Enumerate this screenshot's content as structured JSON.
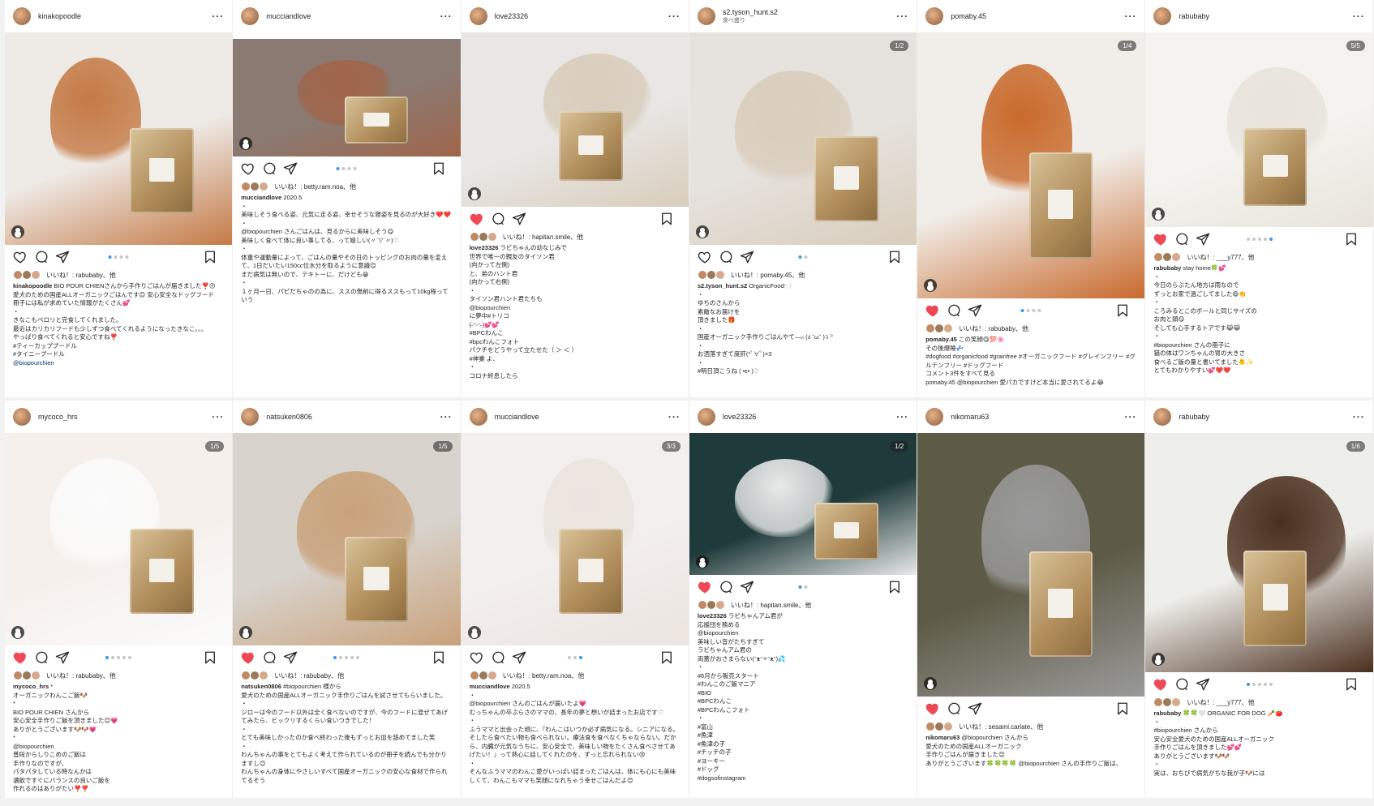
{
  "posts": [
    {
      "username": "kinakopoodle",
      "subtitle": "",
      "counter": "",
      "likes": "いいね！: rabubaby、他",
      "caption_user": "kinakopoodle",
      "caption": " BIO POUR CHIENさんから手作りごはんが届きました❣️😚\n愛犬のための国産ALLオーガニックごはんです😊 安心安全なドッグフード\n冊子には私が求めていた情報がたくさん💕\n・\nきなこもペロリと完食してくれました。\n最近はカリカリフードも少しずつ食べてくれるようになったきなこ。。。\nやっぱり食べてくれると安心ですね❣️\n#ティーカッププードル\n#タイニープードル",
      "link": "@biopourchien",
      "dots": [
        1,
        0,
        0,
        0
      ],
      "active_dot": 0
    },
    {
      "username": "mucciandlove",
      "subtitle": "",
      "counter": "",
      "likes": "いいね！: betty.ram.noa、他",
      "caption_user": "mucciandlove",
      "caption": " 2020.5\n・\n美味しそう食べる姿、元気に走る姿、幸せそうな寝姿を見るのが大好き❤️❤️\n・\n@biopourchien さんごはんは、見るからに美味しそう😋\n美味しく食べて体に良い事してる、って嬉しい(〃ˊ▽ˋ〃)♡\n・\n体重や運動量によって、ごはんの量やその日のトッピングのお肉の量を変えて、1日だいたい150cc位水分を取るように意識😊\nまだ病気は無いので、テキトーに、だけども😁\n・\n１ヶ月一日、パピだちゃのの為に、ススの傷前に得るススもって10kg程っていう",
      "link": "",
      "dots": [
        1,
        0,
        0,
        0
      ],
      "active_dot": 0
    },
    {
      "username": "love23326",
      "subtitle": "",
      "counter": "",
      "likes": "いいね！: hapitan.smile、他",
      "caption_user": "love23326",
      "caption": " ラビちゃんの幼なじみで\n世界で唯一の親友のタイソン君\n(向かって左側)\nと、弟のハント君\n(向かって右側)\n・\nタイソン君ハント君たちも\n@biopourchien\nに夢中#トリコ\n(˶ᵔᵕᵔ˶)💕💕\n#BPCわんこ\n#bpcわんこフォト\nパクチをどうやって立たせた（ ＞ ＜ ）\n#神業 よ、\n・\nコロナ終息したら",
      "link": "",
      "dots": [],
      "active_dot": 0
    },
    {
      "username": "s2.tyson_hunt.s2",
      "subtitle": "食べ盛り",
      "counter": "1/2",
      "likes": "いいね！: pomaby.45、他",
      "caption_user": "s2.tyson_hunt.s2",
      "caption": " OrganicFood🍽️\n・\nゆちのさんから\n素敵なお届けを\n頂きました🎁\n・\n国産オーガニック手作りごはんやて—₍₍ (ง ˘ω˘ )ว ⁾⁾\n・\nお洒落すぎて度肝(*ﾟ∀ﾟ)=3\n・\n#明日頂こうね ( •ε• )♡",
      "link": "",
      "dots": [
        1,
        0
      ],
      "active_dot": 0
    },
    {
      "username": "pomaby.45",
      "subtitle": "",
      "counter": "1/4",
      "likes": "いいね！: rabubaby、他",
      "caption_user": "pomaby.45",
      "caption": " この笑顔😋💯🌸\nその後爆睡💤\n#dogfood #organicfood #grainfree #オーガニックフード #グレインフリー #グルテンフリー #ドッグフード\nコメント3件をすべて見る\npomaby.45 @biopourchien 愛パカですけど本当に愛されてるよ😂",
      "link": "",
      "dots": [
        1,
        0,
        0,
        0
      ],
      "active_dot": 0
    },
    {
      "username": "rabubaby",
      "subtitle": "",
      "counter": "5/5",
      "likes": "いいね！: ___y777、他",
      "caption_user": "rabubaby",
      "caption": " stay home🍀💕\n・\n今日のらぶたん地方は雨なので\nずっとお家で過ごしてました😄👏\n・\nころみるとこのボールと同じサイズの\nお肉と頭😋\nそしても心手するトアです😹😹\n・\n#biopourchien さんの冊子に\n猫の体はワンちゃんの胃の大きさ\n食べるご飯の量と書いてました🐥✨\nとてもわかりやすい💕❤️❤️",
      "link": "",
      "dots": [
        0,
        0,
        0,
        0,
        1
      ],
      "active_dot": 4
    },
    {
      "username": "mycoco_hrs",
      "subtitle": "",
      "counter": "1/5",
      "likes": "いいね！: rabubaby、他",
      "caption_user": "mycoco_hrs",
      "caption": " *\nオーガニックわんこご飯🐶\n*\nBIO POUR CHIEN さんから\n安心安全手作りご飯を頂きました😊💗\nありがとうございます🐶🐶💗\n*\n@biopourchien\n普段からしりこめのご飯は\n手作りなのですが、\nパタパタしている時なんかは\n濃飲ですぐにバランスの良いご飯を\n作れるのはありがたい❣️❣️",
      "link": "",
      "dots": [
        1,
        0,
        0,
        0,
        0
      ],
      "active_dot": 0
    },
    {
      "username": "natsuken0806",
      "subtitle": "",
      "counter": "1/5",
      "likes": "いいね！: rabubaby、他",
      "caption_user": "natsuken0806",
      "caption": " #biopourchien 様から\n愛犬のための国産ALLオーガニック手作りごはんを試させてもらいました。\n・\nジローは今のフード以外は全く食べないのですが、今のフードに混ぜてあげてみたら、ビックリするくらい食いつきでした！\n・\nとても美味しかったのか食べ終わった後もずっとお皿を舐めてました笑\n・\nわんちゃんの事をとてもよく考えて作られているのが冊子を読んでも分かりますし😊\nわんちゃんの身体にやさしいすべて国産オーガニックの安心な食材で作られてるそう",
      "link": "",
      "dots": [
        1,
        0,
        0,
        0,
        0
      ],
      "active_dot": 0
    },
    {
      "username": "mucciandlove",
      "subtitle": "",
      "counter": "3/3",
      "likes": "いいね！: betty.ram.noa、他",
      "caption_user": "mucciandlove",
      "caption": " 2020.5\n・\n@biopourchien さんのごはんが届いたよ💗\nむっちゃんの卒ぷらさのママの、長年の夢と想いが詰まったお店です♡\n・\nふうママと出会った頃に、『わんこはいつか必ず病気になる。シニアになる。そしたら食べたい物も食べられない。療法食を食べなくちゃならない。だから、内臓が元気なうちに、安心安全で、美味しい物をたくさん食べさせてあげたい！』って熱心に話してくれたのを、ずっと忘れられない😢\n・\nそんなふうママのわんこ愛がいっぱい詰まったごはんは、体にも心にも美味しくて、わんこもママも笑顔になれちゃう幸せごはんだよ😊",
      "link": "",
      "dots": [
        0,
        0,
        1
      ],
      "active_dot": 2
    },
    {
      "username": "love23326",
      "subtitle": "",
      "counter": "1/2",
      "likes": "いいね！: hapitan.smile、他",
      "caption_user": "love23326",
      "caption": " ラビちゃんアム君が\n応援団を務める\n@biopourchien\n美味しい音がたちすぎて\nラビちゃんアム君の\n両蓋がおさまらない(ᵔᴥᵔ✧ᵔᴥᵔ)💦\n・\n#6月から販売スタート\n#わんこのご飯マニア\n#BIO\n#BPCわんこ\n#BPCわんこフォト\n・\n#富山\n#魚津\n#魚津の子\n#チッチの子\n#ヨーキー\n#ドッグ\n#dogsofinstagram",
      "link": "",
      "dots": [
        1,
        0
      ],
      "active_dot": 0
    },
    {
      "username": "nikomaru63",
      "subtitle": "",
      "counter": "",
      "likes": "いいね！: sesami.carlate、他",
      "caption_user": "nikomaru63",
      "caption": " @biopourchien さんから\n愛犬のための国産ALLオーガニック\n手作りごはんが届きました😊\nありがとうございます🍀🍀🍀🍀 @biopourchien さんの手作りご飯は、",
      "link": "",
      "dots": [],
      "active_dot": 0
    },
    {
      "username": "rabubaby",
      "subtitle": "",
      "counter": "1/6",
      "likes": "いいね！: ___y777、他",
      "caption_user": "rabubaby",
      "caption": " 🍀🍀🤍 ORGANIC FOR DOG 🥕🍅\n・\n#biopourchien さんから\n安心安全愛犬のための国産ALLオーガニック\n手作りごはんを頂きました💕💕\nありがとうございます🐶🐶\n・\n実は、おちびで病気がちな我が子🐶には",
      "link": "",
      "dots": [
        1,
        0,
        0,
        0,
        0
      ],
      "active_dot": 0
    }
  ],
  "icons": {
    "heart": "heart-icon",
    "comment": "comment-icon",
    "share": "paper-plane-icon",
    "save": "bookmark-icon",
    "more": "more-dots-icon"
  },
  "colors": {
    "like_red": "#ed4956",
    "link_blue": "#003569",
    "dot_active": "#3897f0"
  }
}
